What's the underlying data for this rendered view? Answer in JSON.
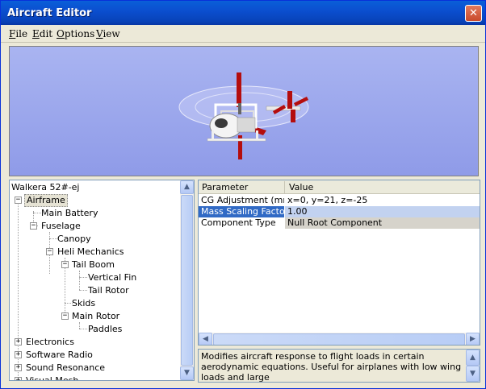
{
  "window": {
    "title": "Aircraft Editor",
    "close_symbol": "✕"
  },
  "menu": {
    "items": [
      "File",
      "Edit",
      "Options",
      "View"
    ]
  },
  "tree": {
    "root": "Walkera 52#-ej",
    "nodes": [
      {
        "label": "Airframe",
        "expander": "−",
        "selected": true
      },
      {
        "label": "Main Battery"
      },
      {
        "label": "Fuselage",
        "expander": "−"
      },
      {
        "label": "Canopy"
      },
      {
        "label": "Heli Mechanics",
        "expander": "−"
      },
      {
        "label": "Tail Boom",
        "expander": "−"
      },
      {
        "label": "Vertical Fin"
      },
      {
        "label": "Tail Rotor"
      },
      {
        "label": "Skids"
      },
      {
        "label": "Main Rotor",
        "expander": "−"
      },
      {
        "label": "Paddles"
      },
      {
        "label": "Electronics",
        "expander": "+"
      },
      {
        "label": "Software Radio",
        "expander": "+"
      },
      {
        "label": "Sound Resonance",
        "expander": "+"
      },
      {
        "label": "Visual Mesh",
        "expander": "+"
      }
    ]
  },
  "grid": {
    "headers": {
      "parameter": "Parameter",
      "value": "Value"
    },
    "rows": [
      {
        "param": "CG Adjustment (mm)",
        "value": "x=0, y=21, z=-25"
      },
      {
        "param": "Mass Scaling Factor",
        "value": "1.00"
      },
      {
        "param": "Component Type",
        "value": "Null Root Component"
      }
    ]
  },
  "description": {
    "text": "Modifies aircraft response to flight loads in certain aerodynamic equations.  Useful for airplanes with low wing loads and large"
  },
  "scroll": {
    "up": "▲",
    "down": "▼",
    "left": "◀",
    "right": "▶"
  },
  "colors": {
    "selection": "#316ac5",
    "viewport_bg": "#9ba6ed",
    "rotor_red": "#b40d0d"
  }
}
